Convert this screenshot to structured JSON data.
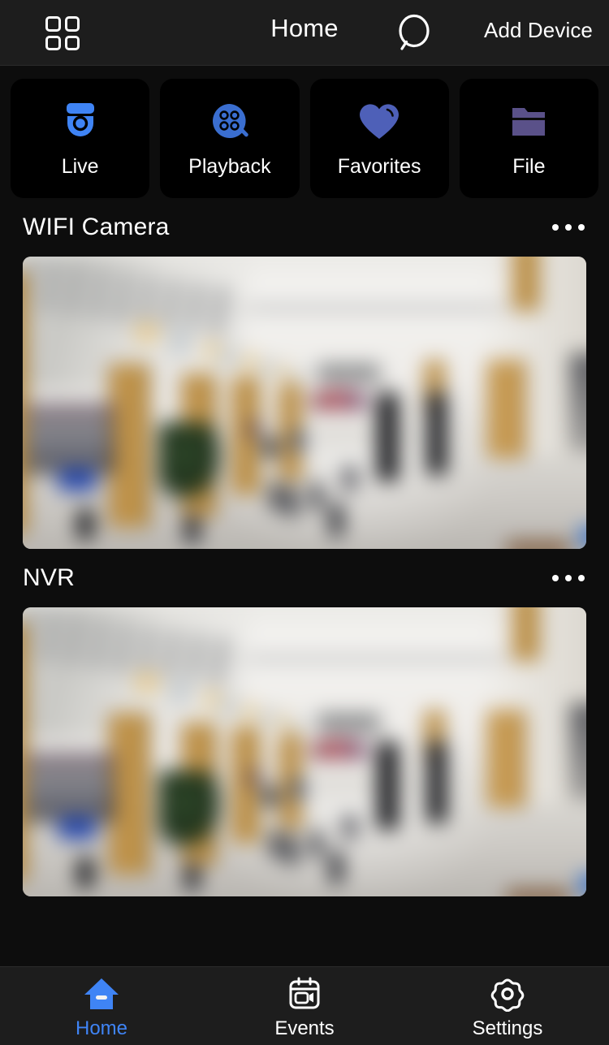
{
  "app": {
    "theme": "dark",
    "background": "#0d0d0d",
    "bar_background": "#1d1d1d",
    "accent": "#3f84f5",
    "accent_secondary": "#4e60b8",
    "accent_folder": "#5a5189"
  },
  "header": {
    "title": "Home",
    "grid_icon": "grid-icon",
    "search_icon": "search-icon",
    "add_device_label": "Add Device"
  },
  "quick_actions": [
    {
      "label": "Live",
      "icon": "dome-camera-icon",
      "color": "#3f84f5"
    },
    {
      "label": "Playback",
      "icon": "film-reel-icon",
      "color": "#3a6ed0"
    },
    {
      "label": "Favorites",
      "icon": "heart-icon",
      "color": "#4e60b8"
    },
    {
      "label": "File",
      "icon": "folder-icon",
      "color": "#5a5189"
    }
  ],
  "devices": [
    {
      "name": "WIFI Camera",
      "menu_icon": "more-options-icon",
      "thumbnail": "live-preview-mall-interior"
    },
    {
      "name": "NVR",
      "menu_icon": "more-options-icon",
      "thumbnail": "live-preview-mall-interior"
    }
  ],
  "bottom_nav": [
    {
      "label": "Home",
      "icon": "home-icon",
      "active": true
    },
    {
      "label": "Events",
      "icon": "calendar-video-icon",
      "active": false
    },
    {
      "label": "Settings",
      "icon": "gear-icon",
      "active": false
    }
  ]
}
